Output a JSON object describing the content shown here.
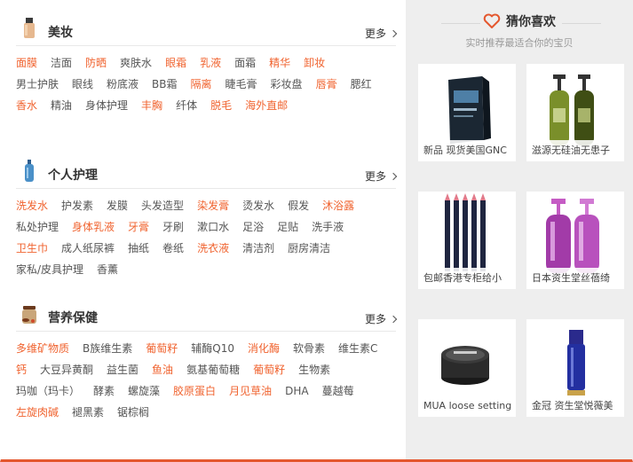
{
  "categories": [
    {
      "title": "美妆",
      "more": "更多",
      "icon": "foundation-bottle-icon",
      "rows": [
        [
          {
            "t": "面膜",
            "hot": true
          },
          {
            "t": "洁面",
            "hot": false
          },
          {
            "t": "防晒",
            "hot": true
          },
          {
            "t": "爽肤水",
            "hot": false
          },
          {
            "t": "眼霜",
            "hot": true
          },
          {
            "t": "乳液",
            "hot": true
          },
          {
            "t": "面霜",
            "hot": false
          },
          {
            "t": "精华",
            "hot": true
          },
          {
            "t": "卸妆",
            "hot": true
          }
        ],
        [
          {
            "t": "男士护肤",
            "hot": false
          },
          {
            "t": "眼线",
            "hot": false
          },
          {
            "t": "粉底液",
            "hot": false
          },
          {
            "t": "BB霜",
            "hot": false
          },
          {
            "t": "隔离",
            "hot": true
          },
          {
            "t": "睫毛膏",
            "hot": false
          },
          {
            "t": "彩妆盘",
            "hot": false
          },
          {
            "t": "唇膏",
            "hot": true
          },
          {
            "t": "腮红",
            "hot": false
          }
        ],
        [
          {
            "t": "香水",
            "hot": true
          },
          {
            "t": "精油",
            "hot": false
          },
          {
            "t": "身体护理",
            "hot": false
          },
          {
            "t": "丰胸",
            "hot": true
          },
          {
            "t": "纤体",
            "hot": false
          },
          {
            "t": "脱毛",
            "hot": true
          },
          {
            "t": "海外直邮",
            "hot": true
          }
        ]
      ]
    },
    {
      "title": "个人护理",
      "more": "更多",
      "icon": "shampoo-bottle-icon",
      "rows": [
        [
          {
            "t": "洗发水",
            "hot": true
          },
          {
            "t": "护发素",
            "hot": false
          },
          {
            "t": "发膜",
            "hot": false
          },
          {
            "t": "头发造型",
            "hot": false
          },
          {
            "t": "染发膏",
            "hot": true
          },
          {
            "t": "烫发水",
            "hot": false
          },
          {
            "t": "假发",
            "hot": false
          },
          {
            "t": "沐浴露",
            "hot": true
          }
        ],
        [
          {
            "t": "私处护理",
            "hot": false
          },
          {
            "t": "身体乳液",
            "hot": true
          },
          {
            "t": "牙膏",
            "hot": true
          },
          {
            "t": "牙刷",
            "hot": false
          },
          {
            "t": "漱口水",
            "hot": false
          },
          {
            "t": "足浴",
            "hot": false
          },
          {
            "t": "足贴",
            "hot": false
          },
          {
            "t": "洗手液",
            "hot": false
          }
        ],
        [
          {
            "t": "卫生巾",
            "hot": true
          },
          {
            "t": "成人纸尿裤",
            "hot": false
          },
          {
            "t": "抽纸",
            "hot": false
          },
          {
            "t": "卷纸",
            "hot": false
          },
          {
            "t": "洗衣液",
            "hot": true
          },
          {
            "t": "清洁剂",
            "hot": false
          },
          {
            "t": "厨房清洁",
            "hot": false
          }
        ],
        [
          {
            "t": "家私/皮具护理",
            "hot": false
          },
          {
            "t": "香薰",
            "hot": false
          }
        ]
      ]
    },
    {
      "title": "营养保健",
      "more": "更多",
      "icon": "supplement-jar-icon",
      "rows": [
        [
          {
            "t": "多维矿物质",
            "hot": true
          },
          {
            "t": "B族维生素",
            "hot": false
          },
          {
            "t": "葡萄籽",
            "hot": true
          },
          {
            "t": "辅酶Q10",
            "hot": false
          },
          {
            "t": "消化酶",
            "hot": true
          },
          {
            "t": "软骨素",
            "hot": false
          },
          {
            "t": "维生素C",
            "hot": false
          }
        ],
        [
          {
            "t": "钙",
            "hot": true
          },
          {
            "t": "大豆异黄酮",
            "hot": false
          },
          {
            "t": "益生菌",
            "hot": false
          },
          {
            "t": "鱼油",
            "hot": true
          },
          {
            "t": "氨基葡萄糖",
            "hot": false
          },
          {
            "t": "葡萄籽",
            "hot": true
          },
          {
            "t": "生物素",
            "hot": false
          }
        ],
        [
          {
            "t": "玛咖（玛卡）",
            "hot": false
          },
          {
            "t": "酵素",
            "hot": false
          },
          {
            "t": "螺旋藻",
            "hot": false
          },
          {
            "t": "胶原蛋白",
            "hot": true
          },
          {
            "t": "月见草油",
            "hot": true
          },
          {
            "t": "DHA",
            "hot": false
          },
          {
            "t": "蔓越莓",
            "hot": false
          }
        ],
        [
          {
            "t": "左旋肉碱",
            "hot": true
          },
          {
            "t": "褪黑素",
            "hot": false
          },
          {
            "t": "锯棕榈",
            "hot": false
          }
        ]
      ]
    }
  ],
  "guess": {
    "title": "猜你喜欢",
    "subtitle": "实时推荐最适合你的宝贝",
    "products": [
      {
        "caption": "新品 现货美国GNC",
        "img": "supplement-box"
      },
      {
        "caption": "滋源无硅油无患子",
        "img": "green-pump-bottles"
      },
      {
        "caption": "包邮香港专柜给小",
        "img": "eyeliner-pencils"
      },
      {
        "caption": "日本资生堂丝蓓绮",
        "img": "purple-pump-bottles"
      },
      {
        "caption": "MUA loose setting",
        "img": "powder-jar"
      },
      {
        "caption": "金冠 资生堂悦薇美",
        "img": "blue-serum-tube"
      }
    ]
  },
  "colors": {
    "accent": "#f0632f",
    "border": "#e4572e",
    "panel": "#eeeeee"
  }
}
